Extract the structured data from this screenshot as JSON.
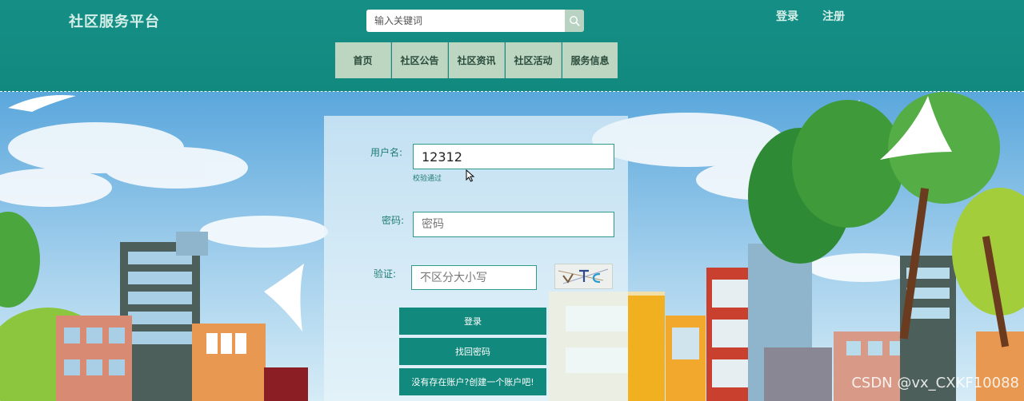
{
  "header": {
    "brand": "社区服务平台",
    "search_placeholder": "输入关键词",
    "login_link": "登录",
    "register_link": "注册"
  },
  "nav": {
    "items": [
      "首页",
      "社区公告",
      "社区资讯",
      "社区活动",
      "服务信息"
    ]
  },
  "login": {
    "username_label": "用户名:",
    "username_value": "12312",
    "username_hint": "校验通过",
    "password_label": "密码:",
    "password_placeholder": "密码",
    "captcha_label": "验证:",
    "captcha_placeholder": "不区分大小写",
    "login_button": "登录",
    "recover_button": "找回密码",
    "register_prompt": "没有存在账户?创建一个账户吧!"
  },
  "watermark": "CSDN @vx_CXKF10088",
  "colors": {
    "header_bg": "#158f86",
    "nav_item_bg": "#bcd6c2",
    "button_bg": "#11897c",
    "label_text": "#1f7c74"
  }
}
